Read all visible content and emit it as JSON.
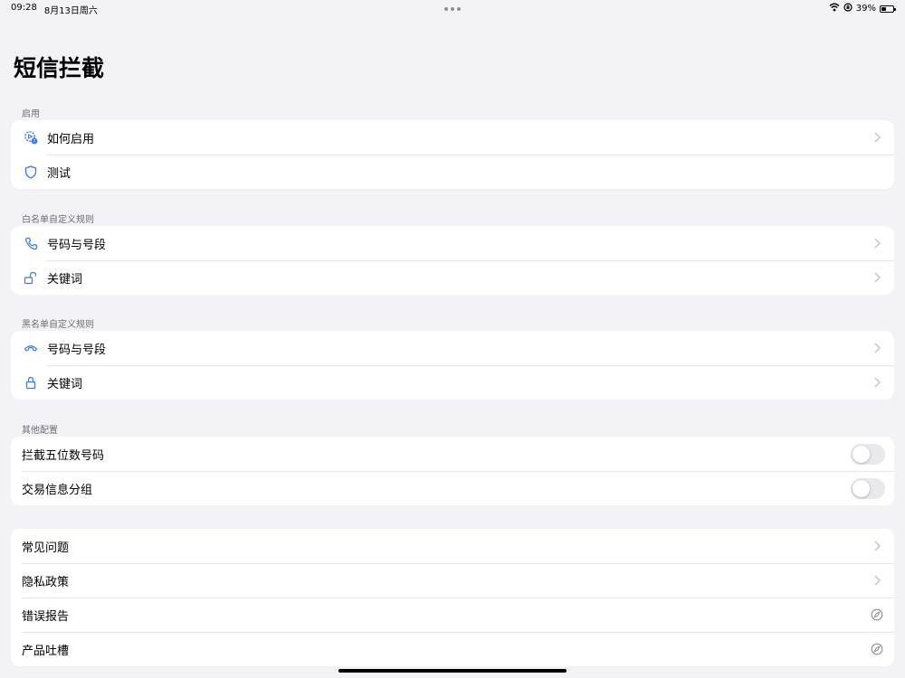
{
  "status_bar": {
    "time": "09:28",
    "date": "8月13日周六",
    "battery": "39%",
    "battery_level": 0.39
  },
  "page_title": "短信拦截",
  "sections": {
    "enable": {
      "header": "启用",
      "items": [
        {
          "label": "如何启用",
          "icon": "gear-question-icon",
          "accessory": "chevron"
        },
        {
          "label": "测试",
          "icon": "shield-icon",
          "accessory": "none"
        }
      ]
    },
    "whitelist": {
      "header": "白名单自定义规则",
      "items": [
        {
          "label": "号码与号段",
          "icon": "phone-icon",
          "accessory": "chevron"
        },
        {
          "label": "关键词",
          "icon": "unlock-icon",
          "accessory": "chevron"
        }
      ]
    },
    "blacklist": {
      "header": "黑名单自定义规则",
      "items": [
        {
          "label": "号码与号段",
          "icon": "phone-down-icon",
          "accessory": "chevron"
        },
        {
          "label": "关键词",
          "icon": "lock-icon",
          "accessory": "chevron"
        }
      ]
    },
    "other": {
      "header": "其他配置",
      "items": [
        {
          "label": "拦截五位数号码",
          "accessory": "toggle",
          "value": false
        },
        {
          "label": "交易信息分组",
          "accessory": "toggle",
          "value": false
        }
      ]
    },
    "support": {
      "items": [
        {
          "label": "常见问题",
          "accessory": "chevron"
        },
        {
          "label": "隐私政策",
          "accessory": "chevron"
        },
        {
          "label": "错误报告",
          "accessory": "compass-icon"
        },
        {
          "label": "产品吐槽",
          "accessory": "compass-icon"
        }
      ]
    }
  },
  "colors": {
    "accent": "#3478f6",
    "background": "#f2f2f7",
    "chevron": "#c4c4c7"
  }
}
